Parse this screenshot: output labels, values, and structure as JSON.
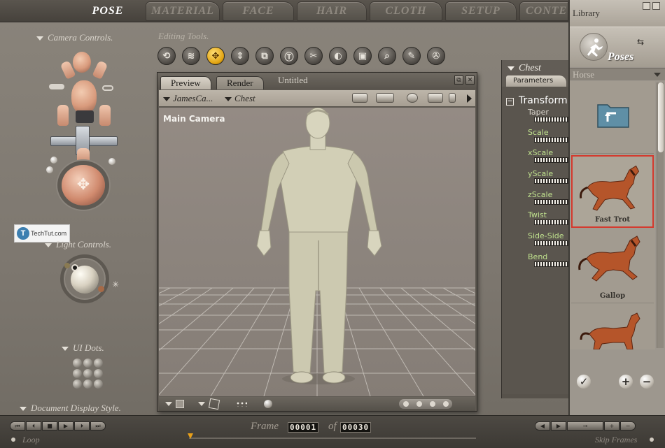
{
  "tabs": [
    {
      "label": "POSE",
      "active": true
    },
    {
      "label": "MATERIAL",
      "active": false
    },
    {
      "label": "FACE",
      "active": false
    },
    {
      "label": "HAIR",
      "active": false
    },
    {
      "label": "CLOTH",
      "active": false
    },
    {
      "label": "SETUP",
      "active": false
    },
    {
      "label": "CONTE",
      "active": false
    }
  ],
  "left_panel": {
    "camera_controls": "Camera Controls.",
    "light_controls": "Light Controls.",
    "ui_dots": "UI Dots.",
    "document_display_style": "Document Display Style."
  },
  "watermark": {
    "logo": "T",
    "text": "TechTut.com"
  },
  "editing_tools": {
    "title": "Editing Tools.",
    "tools": [
      {
        "icon": "rotate-icon",
        "glyph": "⟲"
      },
      {
        "icon": "twist-icon",
        "glyph": "≋"
      },
      {
        "icon": "translate-icon",
        "glyph": "✥",
        "active": true
      },
      {
        "icon": "translate-in-out-icon",
        "glyph": "⇕"
      },
      {
        "icon": "scale-icon",
        "glyph": "⧉"
      },
      {
        "icon": "taper-icon",
        "glyph": "Ⓣ"
      },
      {
        "icon": "chain-break-icon",
        "glyph": "✂"
      },
      {
        "icon": "color-icon",
        "glyph": "◐"
      },
      {
        "icon": "grouping-icon",
        "glyph": "▣"
      },
      {
        "icon": "view-magnifier-icon",
        "glyph": "⌕"
      },
      {
        "icon": "morph-brush-icon",
        "glyph": "✎"
      },
      {
        "icon": "direct-manipulation-icon",
        "glyph": "✇"
      }
    ]
  },
  "document": {
    "tab_preview": "Preview",
    "tab_render": "Render",
    "title": "Untitled",
    "figure_select": "JamesCa...",
    "part_select": "Chest",
    "camera_label": "Main Camera"
  },
  "parameters": {
    "title": "Chest",
    "tab": "Parameters",
    "group_toggle": "−",
    "group": "Transform",
    "dials": [
      "Taper",
      "Scale",
      "xScale",
      "yScale",
      "zScale",
      "Twist",
      "Side-Side",
      "Bend"
    ]
  },
  "library": {
    "title": "Library",
    "category": "Poses",
    "subcategory": "Horse",
    "items": [
      {
        "label": "",
        "type": "folder"
      },
      {
        "label": "Fast Trot",
        "selected": true
      },
      {
        "label": "Gallop"
      },
      {
        "label": ""
      }
    ]
  },
  "animation": {
    "frame_label": "Frame",
    "of_label": "of",
    "current_frame": "00001",
    "total_frames": "00030",
    "loop_label": "Loop",
    "skip_frames_label": "Skip Frames"
  },
  "colors": {
    "accent_active_tool": "#e3a512",
    "selection_border": "#d43a2e",
    "param_label": "#bfe08d",
    "horse_body": "#b5552a"
  }
}
